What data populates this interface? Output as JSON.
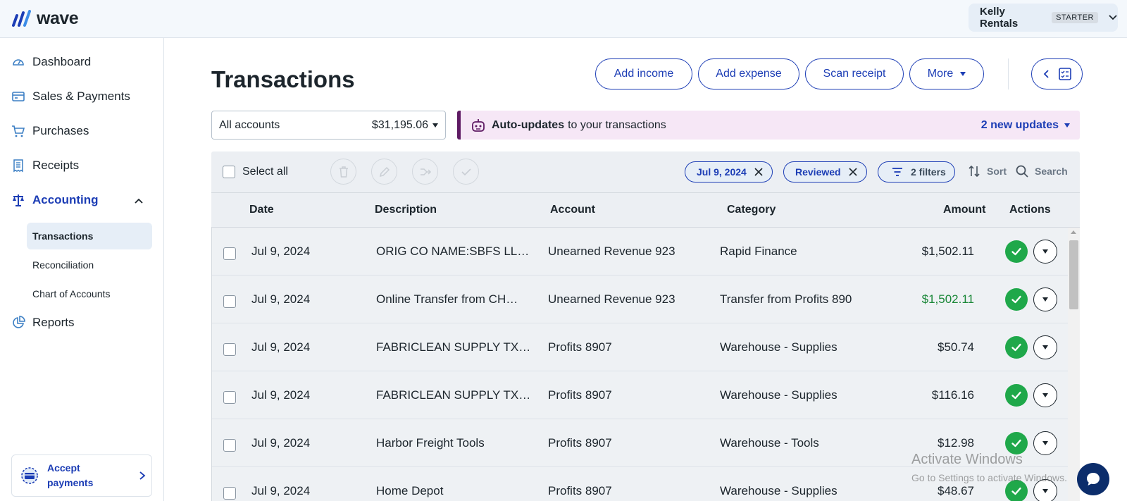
{
  "brand": {
    "name": "wave"
  },
  "business": {
    "name": "Kelly Rentals",
    "plan": "STARTER"
  },
  "sidebar": {
    "items": [
      {
        "label": "Dashboard"
      },
      {
        "label": "Sales & Payments"
      },
      {
        "label": "Purchases"
      },
      {
        "label": "Receipts"
      },
      {
        "label": "Accounting"
      },
      {
        "label": "Reports"
      }
    ],
    "accounting_sub": [
      {
        "label": "Transactions"
      },
      {
        "label": "Reconciliation"
      },
      {
        "label": "Chart of Accounts"
      }
    ],
    "accept_payments": "Accept payments"
  },
  "page": {
    "title": "Transactions",
    "buttons": {
      "add_income": "Add income",
      "add_expense": "Add expense",
      "scan_receipt": "Scan receipt",
      "more": "More"
    }
  },
  "account_selector": {
    "label": "All accounts",
    "balance": "$31,195.06"
  },
  "auto_updates": {
    "bold": "Auto-updates",
    "rest": "to your transactions",
    "link": "2 new updates"
  },
  "toolbar": {
    "select_all": "Select all",
    "chips": [
      "Jul 9, 2024",
      "Reviewed"
    ],
    "filters": "2 filters",
    "sort": "Sort",
    "search": "Search"
  },
  "table": {
    "headers": {
      "date": "Date",
      "description": "Description",
      "account": "Account",
      "category": "Category",
      "amount": "Amount",
      "actions": "Actions"
    },
    "rows": [
      {
        "date": "Jul 9, 2024",
        "description": "ORIG CO NAME:SBFS LL…",
        "account": "Unearned Revenue 923",
        "category": "Rapid Finance",
        "amount": "$1,502.11",
        "income": false
      },
      {
        "date": "Jul 9, 2024",
        "description": "Online Transfer from CH…",
        "account": "Unearned Revenue 923",
        "category": "Transfer from Profits 890",
        "amount": "$1,502.11",
        "income": true
      },
      {
        "date": "Jul 9, 2024",
        "description": "FABRICLEAN SUPPLY TX…",
        "account": "Profits 8907",
        "category": "Warehouse - Supplies",
        "amount": "$50.74",
        "income": false
      },
      {
        "date": "Jul 9, 2024",
        "description": "FABRICLEAN SUPPLY TX…",
        "account": "Profits 8907",
        "category": "Warehouse - Supplies",
        "amount": "$116.16",
        "income": false
      },
      {
        "date": "Jul 9, 2024",
        "description": "Harbor Freight Tools",
        "account": "Profits 8907",
        "category": "Warehouse - Tools",
        "amount": "$12.98",
        "income": false
      },
      {
        "date": "Jul 9, 2024",
        "description": "Home Depot",
        "account": "Profits 8907",
        "category": "Warehouse - Supplies",
        "amount": "$48.67",
        "income": false
      }
    ]
  },
  "watermark": {
    "line1": "Activate Windows",
    "line2": "Go to Settings to activate Windows."
  },
  "colors": {
    "accent": "#1c3db5",
    "success": "#1fa84a",
    "income_text": "#198737",
    "banner_bg": "#f6e7f6",
    "banner_border": "#5e1a63"
  }
}
